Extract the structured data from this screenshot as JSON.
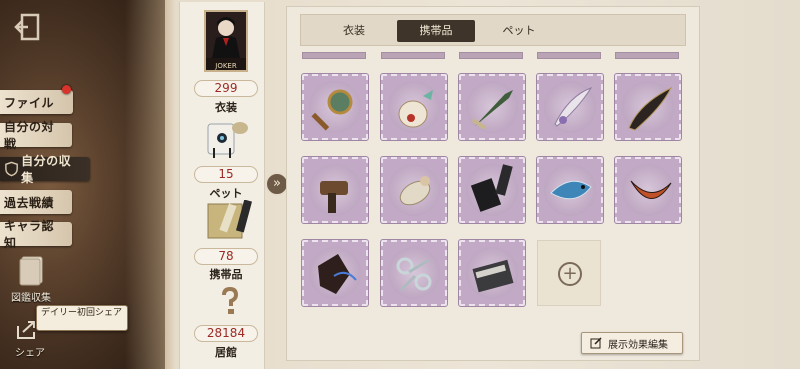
{
  "sidebar": {
    "items": [
      {
        "label": "ファイル",
        "badge": true
      },
      {
        "label": "自分の対戦"
      },
      {
        "label": "自分の収集",
        "active": true
      },
      {
        "label": "過去戦績"
      },
      {
        "label": "キャラ認知"
      }
    ],
    "collection_label": "図鑑収集",
    "share_label": "シェア",
    "tooltip_text": "デイリー初回シェア"
  },
  "stats": {
    "portrait_name": "JOKER",
    "costume_count": "299",
    "costume_label": "衣装",
    "pet_count": "15",
    "pet_label": "ペット",
    "accessory_count": "78",
    "accessory_label": "携帯品",
    "residence_count": "28184",
    "residence_label": "居館"
  },
  "tabs": {
    "costume": "衣装",
    "accessory": "携帯品",
    "pet": "ペット"
  },
  "items": [
    {
      "icon": "hand-mirror-icon"
    },
    {
      "icon": "potion-bottle-icon"
    },
    {
      "icon": "feather-dagger-icon"
    },
    {
      "icon": "quill-feather-icon"
    },
    {
      "icon": "black-wing-icon"
    },
    {
      "icon": "hammer-icon"
    },
    {
      "icon": "doll-icon"
    },
    {
      "icon": "black-book-icon"
    },
    {
      "icon": "blue-fish-icon"
    },
    {
      "icon": "orange-feather-icon"
    },
    {
      "icon": "dark-cloth-icon"
    },
    {
      "icon": "silver-scissors-icon"
    },
    {
      "icon": "book-clip-icon"
    }
  ],
  "edit_button_label": "展示効果編集",
  "colors": {
    "stamp_purple": "#c2a9c5",
    "value_red": "#9b2a26",
    "active_tab": "#3e342a"
  }
}
